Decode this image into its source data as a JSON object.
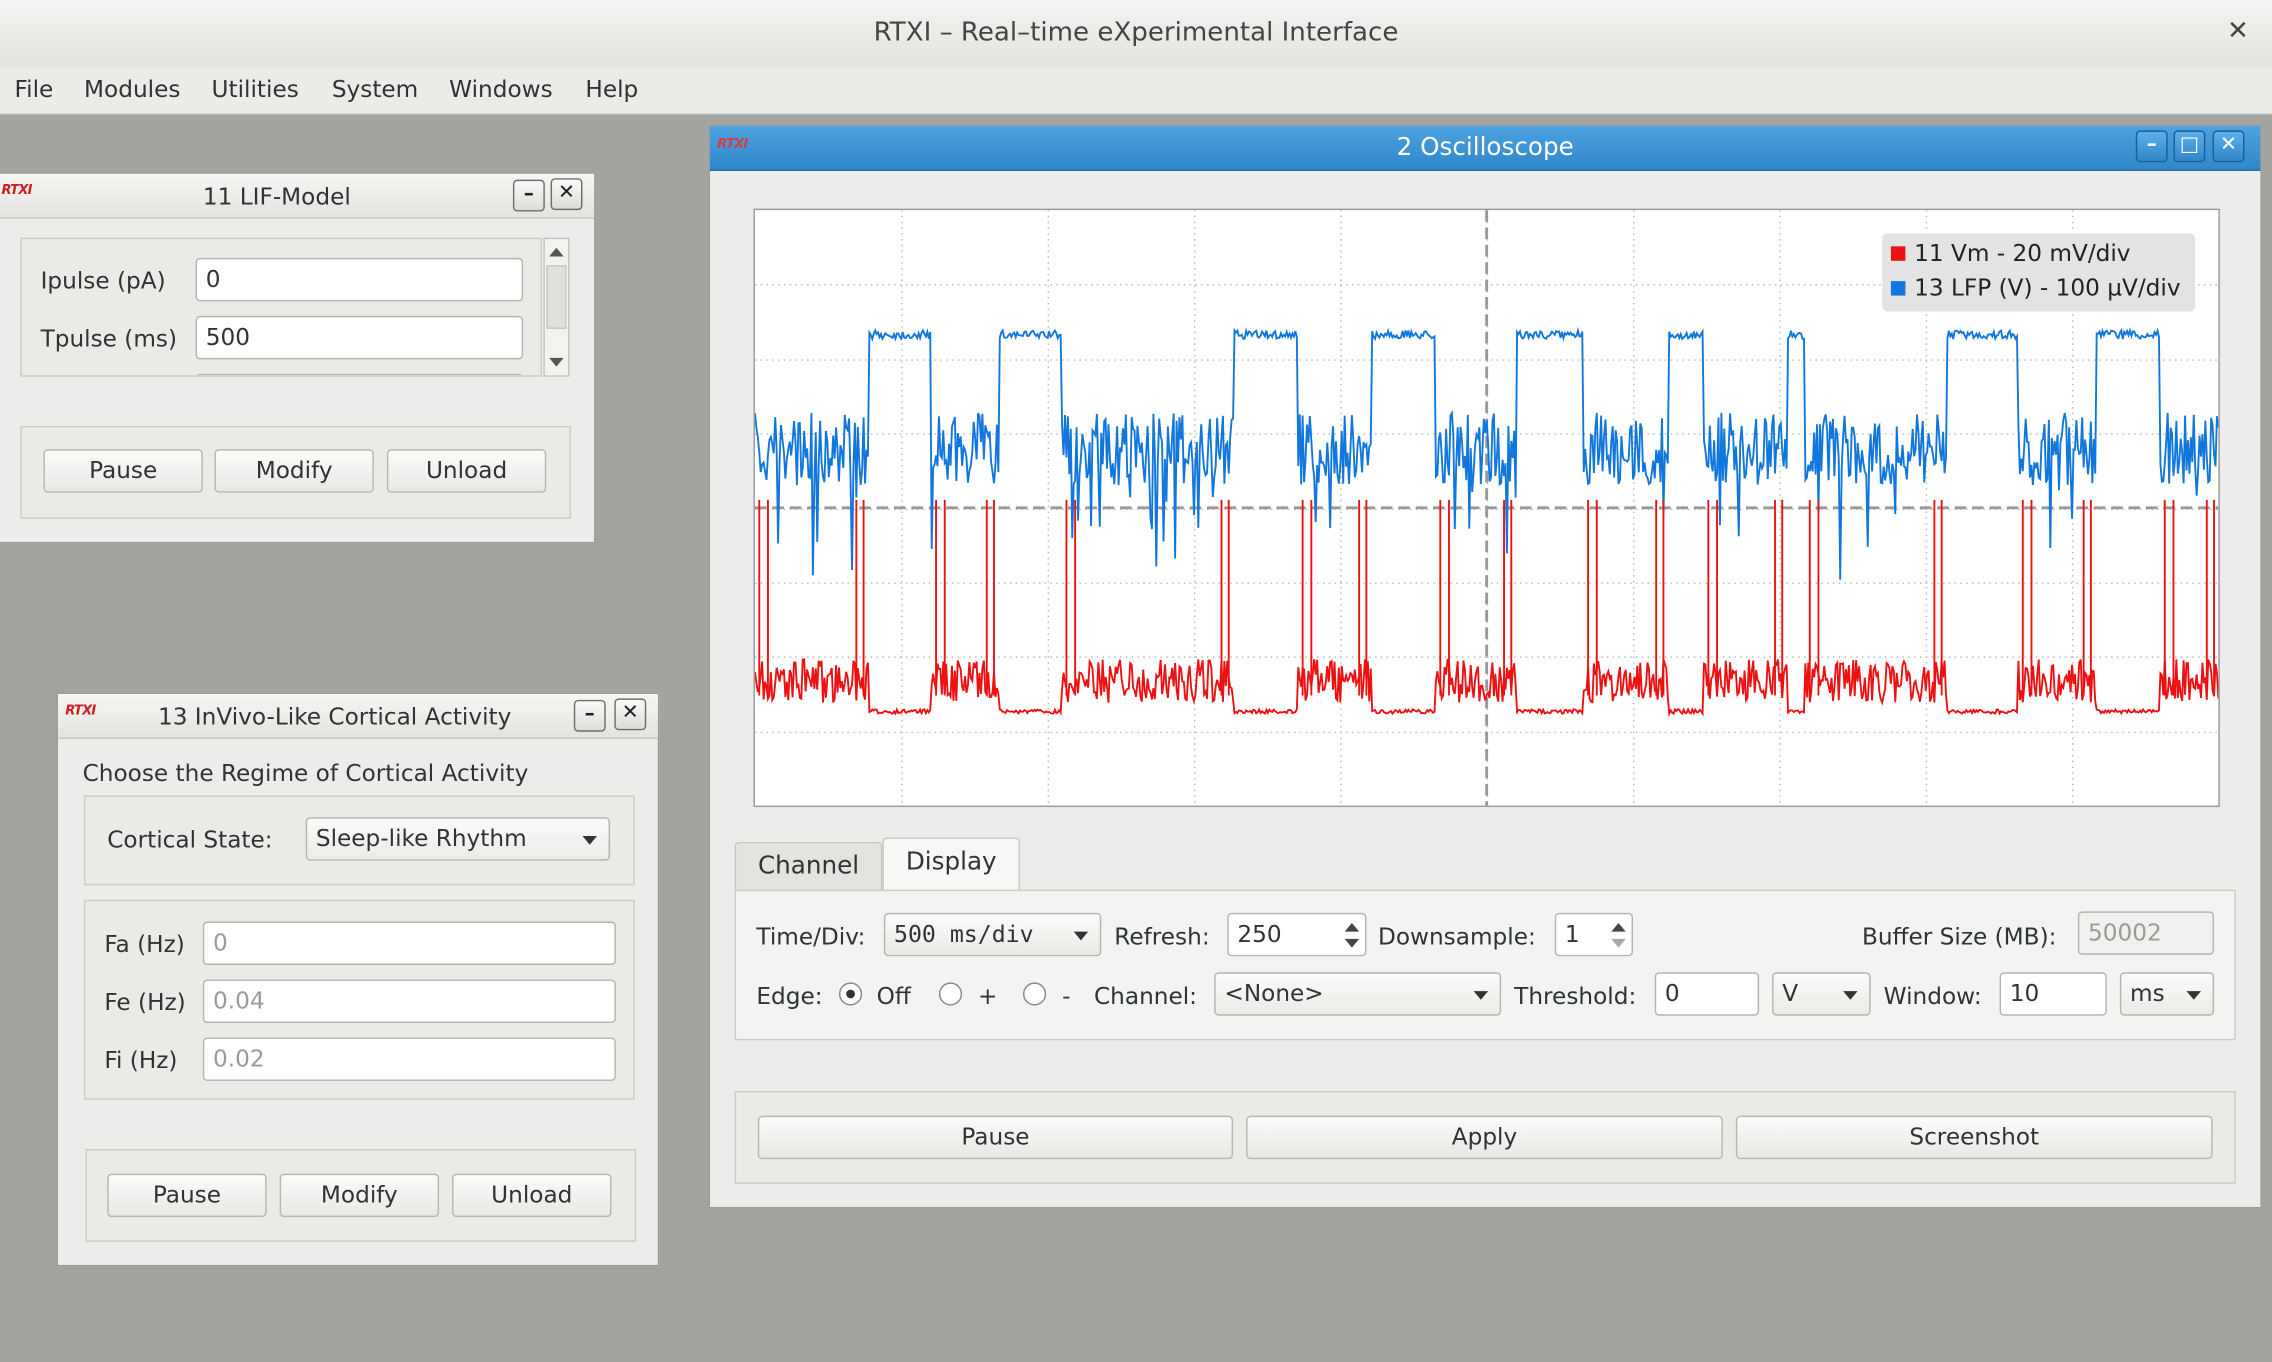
{
  "app": {
    "title": "RTXI – Real–time eXperimental Interface",
    "close_glyph": "✕",
    "logo_text": "RTXI"
  },
  "menu": [
    "File",
    "Modules",
    "Utilities",
    "System",
    "Windows",
    "Help"
  ],
  "lif": {
    "title": "11 LIF-Model",
    "ipulse_label": "Ipulse (pA)",
    "ipulse_value": "0",
    "tpulse_label": "Tpulse (ms)",
    "tpulse_value": "500",
    "pause": "Pause",
    "modify": "Modify",
    "unload": "Unload"
  },
  "cortical": {
    "title": "13 InVivo-Like Cortical Activity",
    "heading": "Choose the Regime of Cortical Activity",
    "state_label": "Cortical State:",
    "state_value": "Sleep-like Rhythm",
    "fa_label": "Fa (Hz)",
    "fa_value": "0",
    "fe_label": "Fe (Hz)",
    "fe_value": "0.04",
    "fi_label": "Fi (Hz)",
    "fi_value": "0.02",
    "pause": "Pause",
    "modify": "Modify",
    "unload": "Unload"
  },
  "osc": {
    "title": "2 Oscilloscope",
    "legend": [
      {
        "text": "11 Vm - 20 mV/div",
        "color": "#ee1111"
      },
      {
        "text": "13 LFP (V) - 100 µV/div",
        "color": "#1177dd"
      }
    ],
    "tabs": [
      "Channel",
      "Display"
    ],
    "active_tab": "Display",
    "time_div_label": "Time/Div:",
    "time_div_value": "500 ms/div",
    "refresh_label": "Refresh:",
    "refresh_value": "250",
    "downsample_label": "Downsample:",
    "downsample_value": "1",
    "buffer_label": "Buffer Size (MB):",
    "buffer_value": "50002",
    "edge_label": "Edge:",
    "edge_options": [
      "Off",
      "+",
      "-"
    ],
    "edge_selected": "Off",
    "channel_label": "Channel:",
    "channel_value": "<None>",
    "threshold_label": "Threshold:",
    "threshold_value": "0",
    "threshold_unit": "V",
    "window_label": "Window:",
    "window_value": "10",
    "window_unit": "ms",
    "pause": "Pause",
    "apply": "Apply",
    "screenshot": "Screenshot"
  },
  "colors": {
    "vm_trace": "#ee1111",
    "lfp_trace": "#1177dd",
    "title_active": "#2f86c9"
  }
}
